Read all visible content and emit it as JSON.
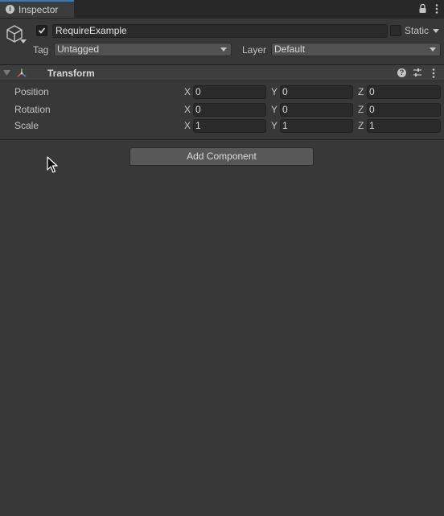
{
  "tab": {
    "title": "Inspector"
  },
  "header": {
    "object_name": "RequireExample",
    "active": true,
    "static_label": "Static",
    "static_checked": false,
    "tag_label": "Tag",
    "tag_value": "Untagged",
    "layer_label": "Layer",
    "layer_value": "Default"
  },
  "component": {
    "title": "Transform",
    "rows": [
      {
        "label": "Position",
        "x": "0",
        "y": "0",
        "z": "0"
      },
      {
        "label": "Rotation",
        "x": "0",
        "y": "0",
        "z": "0"
      },
      {
        "label": "Scale",
        "x": "1",
        "y": "1",
        "z": "1"
      }
    ]
  },
  "axes": {
    "x": "X",
    "y": "Y",
    "z": "Z"
  },
  "add_component_label": "Add Component",
  "colors": {
    "tab_accent": "#3a79bb",
    "background": "#383838"
  }
}
